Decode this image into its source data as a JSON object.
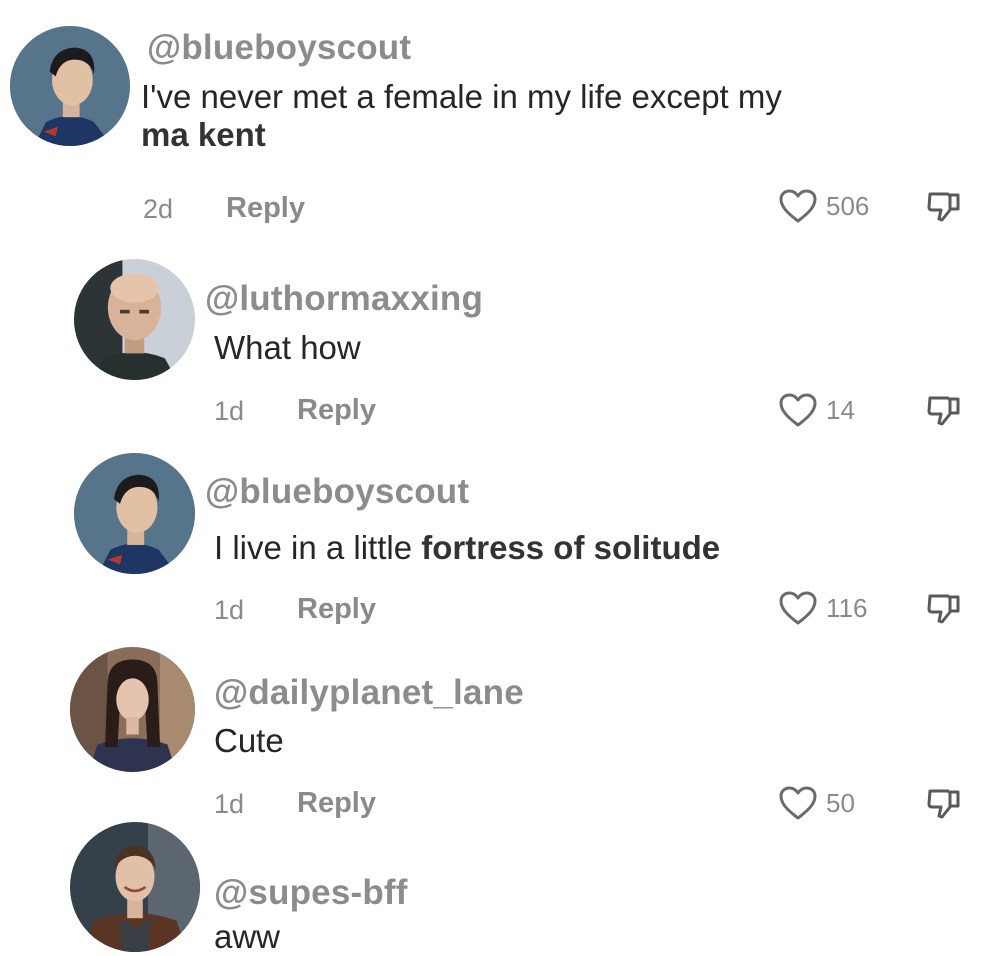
{
  "comments": [
    {
      "username": "@blueboyscout",
      "text_line1": "I've never met a female in my life except my",
      "text_line2": "ma kent",
      "age": "2d",
      "reply_label": "Reply",
      "likes": "506",
      "avatar_icon": "avatar-superman"
    },
    {
      "username": "@luthormaxxing",
      "text": "What how",
      "age": "1d",
      "reply_label": "Reply",
      "likes": "14",
      "avatar_icon": "avatar-luthor"
    },
    {
      "username": "@blueboyscout",
      "text_part1": "I live in a little ",
      "text_part2": "fortress of solitude",
      "age": "1d",
      "reply_label": "Reply",
      "likes": "116",
      "avatar_icon": "avatar-superman"
    },
    {
      "username": "@dailyplanet_lane",
      "text": "Cute",
      "age": "1d",
      "reply_label": "Reply",
      "likes": "50",
      "avatar_icon": "avatar-lois"
    },
    {
      "username": "@supes-bff",
      "text": "aww",
      "avatar_icon": "avatar-jimmy"
    }
  ],
  "icons": {
    "like": "heart-outline-icon",
    "dislike": "thumbs-down-icon"
  },
  "colors": {
    "username": "#8c8c8c",
    "meta": "#8a8a8a",
    "text": "#262626"
  }
}
